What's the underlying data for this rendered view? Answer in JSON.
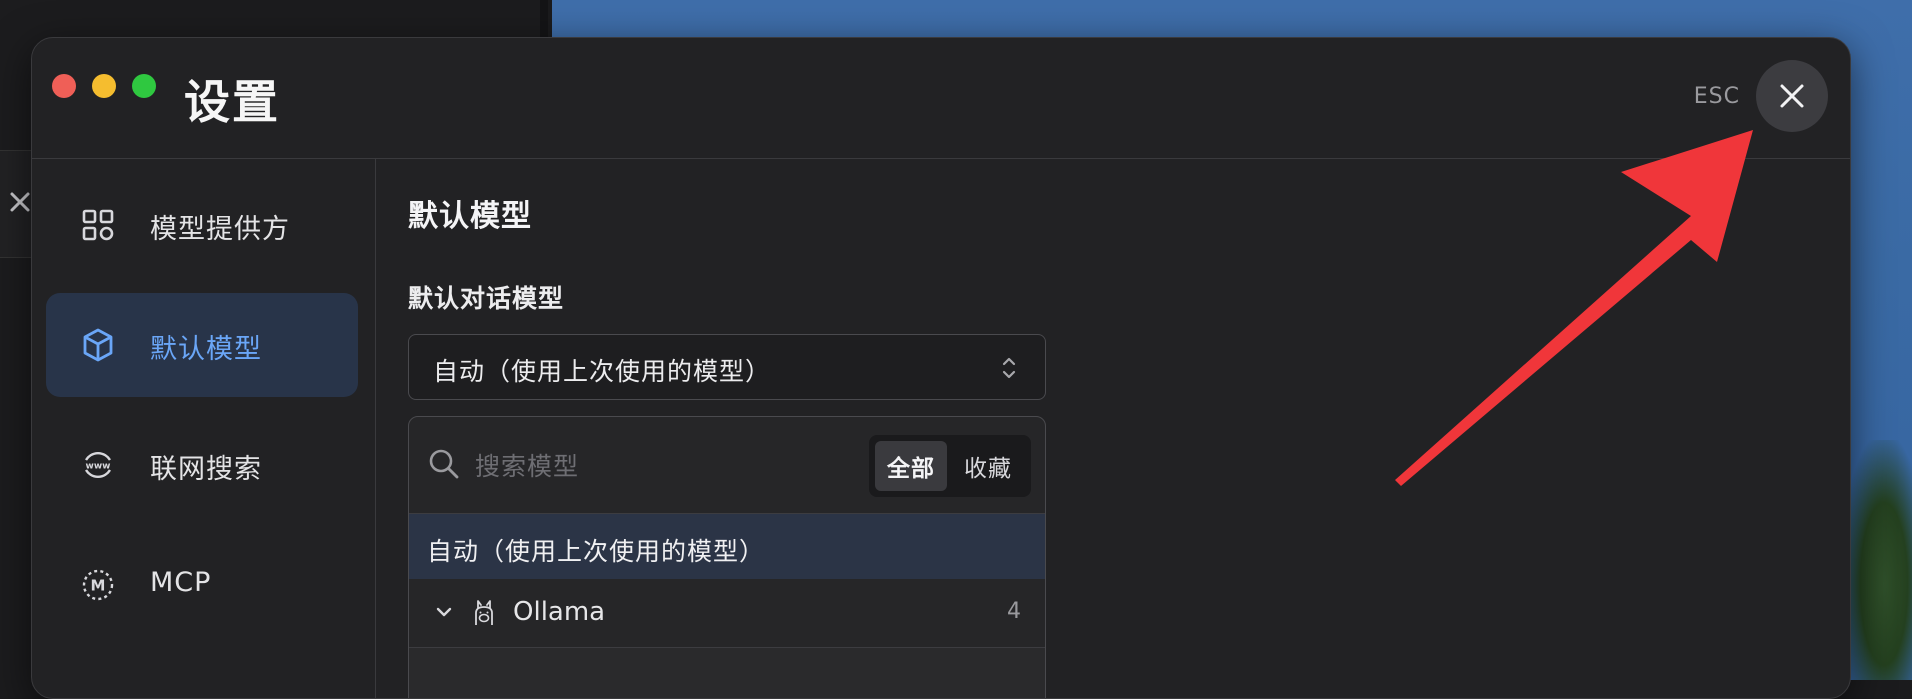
{
  "window": {
    "title": "设置",
    "esc_label": "ESC"
  },
  "sidebar": {
    "items": [
      {
        "label": "模型提供方",
        "icon": "grid-icon",
        "active": false
      },
      {
        "label": "默认模型",
        "icon": "cube-icon",
        "active": true
      },
      {
        "label": "联网搜索",
        "icon": "www-globe-icon",
        "active": false
      },
      {
        "label": "MCP",
        "icon": "mcp-icon",
        "active": false
      }
    ]
  },
  "main": {
    "section_title": "默认模型",
    "chat_model_label": "默认对话模型",
    "select_value": "自动（使用上次使用的模型）",
    "dropdown": {
      "search_placeholder": "搜索模型",
      "filter_all": "全部",
      "filter_favorites": "收藏",
      "options": [
        {
          "label": "自动（使用上次使用的模型）",
          "selected": true
        }
      ],
      "groups": [
        {
          "label": "Ollama",
          "count": "4",
          "expanded": true
        }
      ]
    }
  },
  "colors": {
    "accent": "#6aa6f7",
    "active_bg": "#283449",
    "annotation_arrow": "#f0363a"
  }
}
